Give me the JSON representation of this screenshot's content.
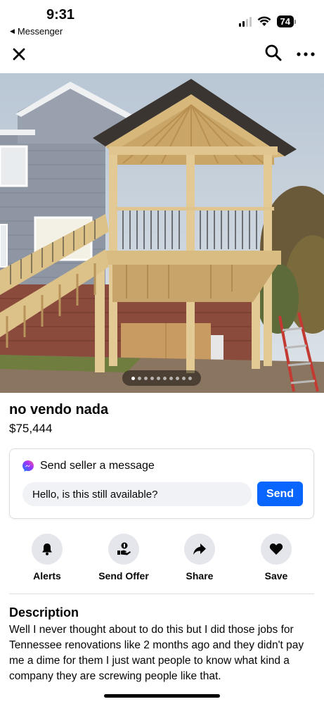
{
  "status_bar": {
    "time": "9:31",
    "back_app": "Messenger",
    "battery": "74"
  },
  "icons": {
    "close": "close-icon",
    "search": "search-icon",
    "more": "more-options-icon",
    "messenger": "messenger-icon",
    "alerts": "bell-icon",
    "send_offer": "send-offer-icon",
    "share": "share-arrow-icon",
    "save": "heart-icon"
  },
  "carousel": {
    "total": 10,
    "active_index": 0
  },
  "listing": {
    "title": "no vendo nada",
    "price": "$75,444"
  },
  "message_card": {
    "heading": "Send seller a message",
    "input_value": "Hello, is this still available?",
    "send_label": "Send"
  },
  "actions": [
    {
      "label": "Alerts"
    },
    {
      "label": "Send Offer"
    },
    {
      "label": "Share"
    },
    {
      "label": "Save"
    }
  ],
  "description": {
    "heading": "Description",
    "body": "Well I never thought about to do this but I did those jobs for Tennessee renovations like 2 months ago and they didn't pay me a dime for them I just want people to know what kind a company they are screwing people like that."
  },
  "colors": {
    "accent": "#0866ff",
    "action_circle": "#e4e6eb",
    "input_bg": "#f0f2f5",
    "text": "#050505"
  }
}
